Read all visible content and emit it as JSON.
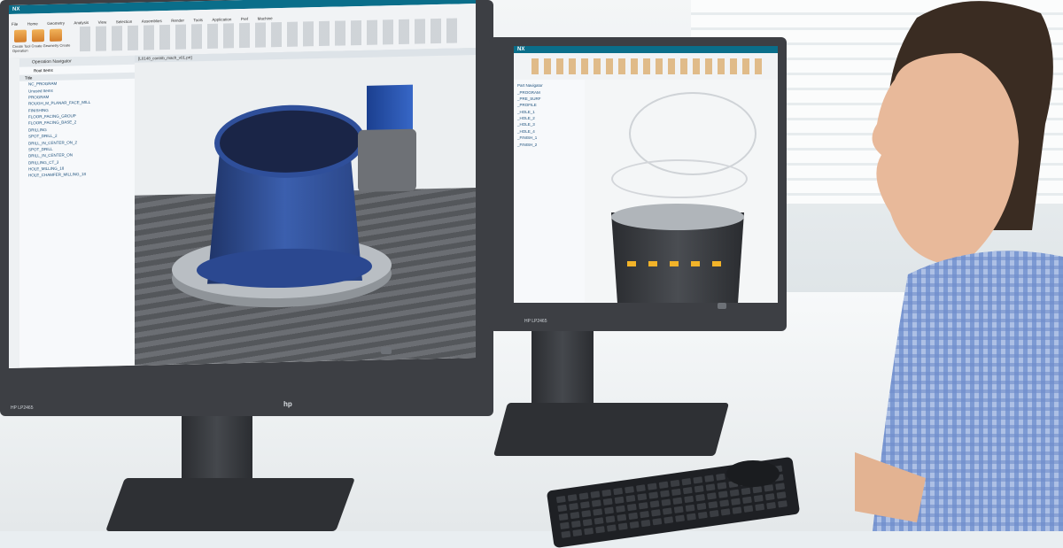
{
  "left_monitor": {
    "brand": "hp",
    "model": "HP LP2465",
    "app": {
      "logo": "NX",
      "menu_tabs": [
        "File",
        "Home",
        "Geometry",
        "Analysis",
        "View",
        "Selection",
        "Assemblies",
        "Render",
        "Tools",
        "Application",
        "Pref",
        "Machine"
      ],
      "ribbon_buttons": [
        "Create Tool",
        "Create Geometry",
        "Create Operation"
      ],
      "navigator_title": "Operation Navigator",
      "filter_value": "Root Items",
      "tree_header": "Title",
      "tree_rows": [
        "NC_PROGRAM",
        "Unused Items",
        "PROGRAM",
        "ROUGH_M_PLANAR_FACE_MILL",
        "FINISHING",
        "FLOOR_FACING_GROUP",
        "FLOOR_FACING_BASE_2",
        "DRILLING",
        "SPOT_DRILL_2",
        "DRILL_IN_CENTER_ON_2",
        "SPOT_DRILL",
        "DRILL_IN_CENTER_ON",
        "DRILLING_CT_3",
        "HOLE_MILLING_18",
        "HOLE_CHAMFER_MILLING_18"
      ],
      "doc_tab": "[L0148_contrib_mach_v01.prt]"
    }
  },
  "right_monitor": {
    "brand": "hp",
    "model": "HP LP2465",
    "app": {
      "logo": "NX",
      "tree_rows": [
        "Part Navigator",
        "_PROGRAM",
        "_PRE_SURF",
        "_PROFILE",
        "_HOLE_1",
        "_HOLE_2",
        "_HOLE_3",
        "_HOLE_4",
        "_FINISH_1",
        "_FINISH_2"
      ]
    }
  },
  "icons": {
    "keyboard": "keyboard-icon",
    "mouse": "mouse-icon"
  },
  "colors": {
    "nx_title_bar": "#0a6e8a",
    "part_blue": "#2f4f9a",
    "fixture_gray": "#b9bec3",
    "bezel": "#3d3f44"
  }
}
